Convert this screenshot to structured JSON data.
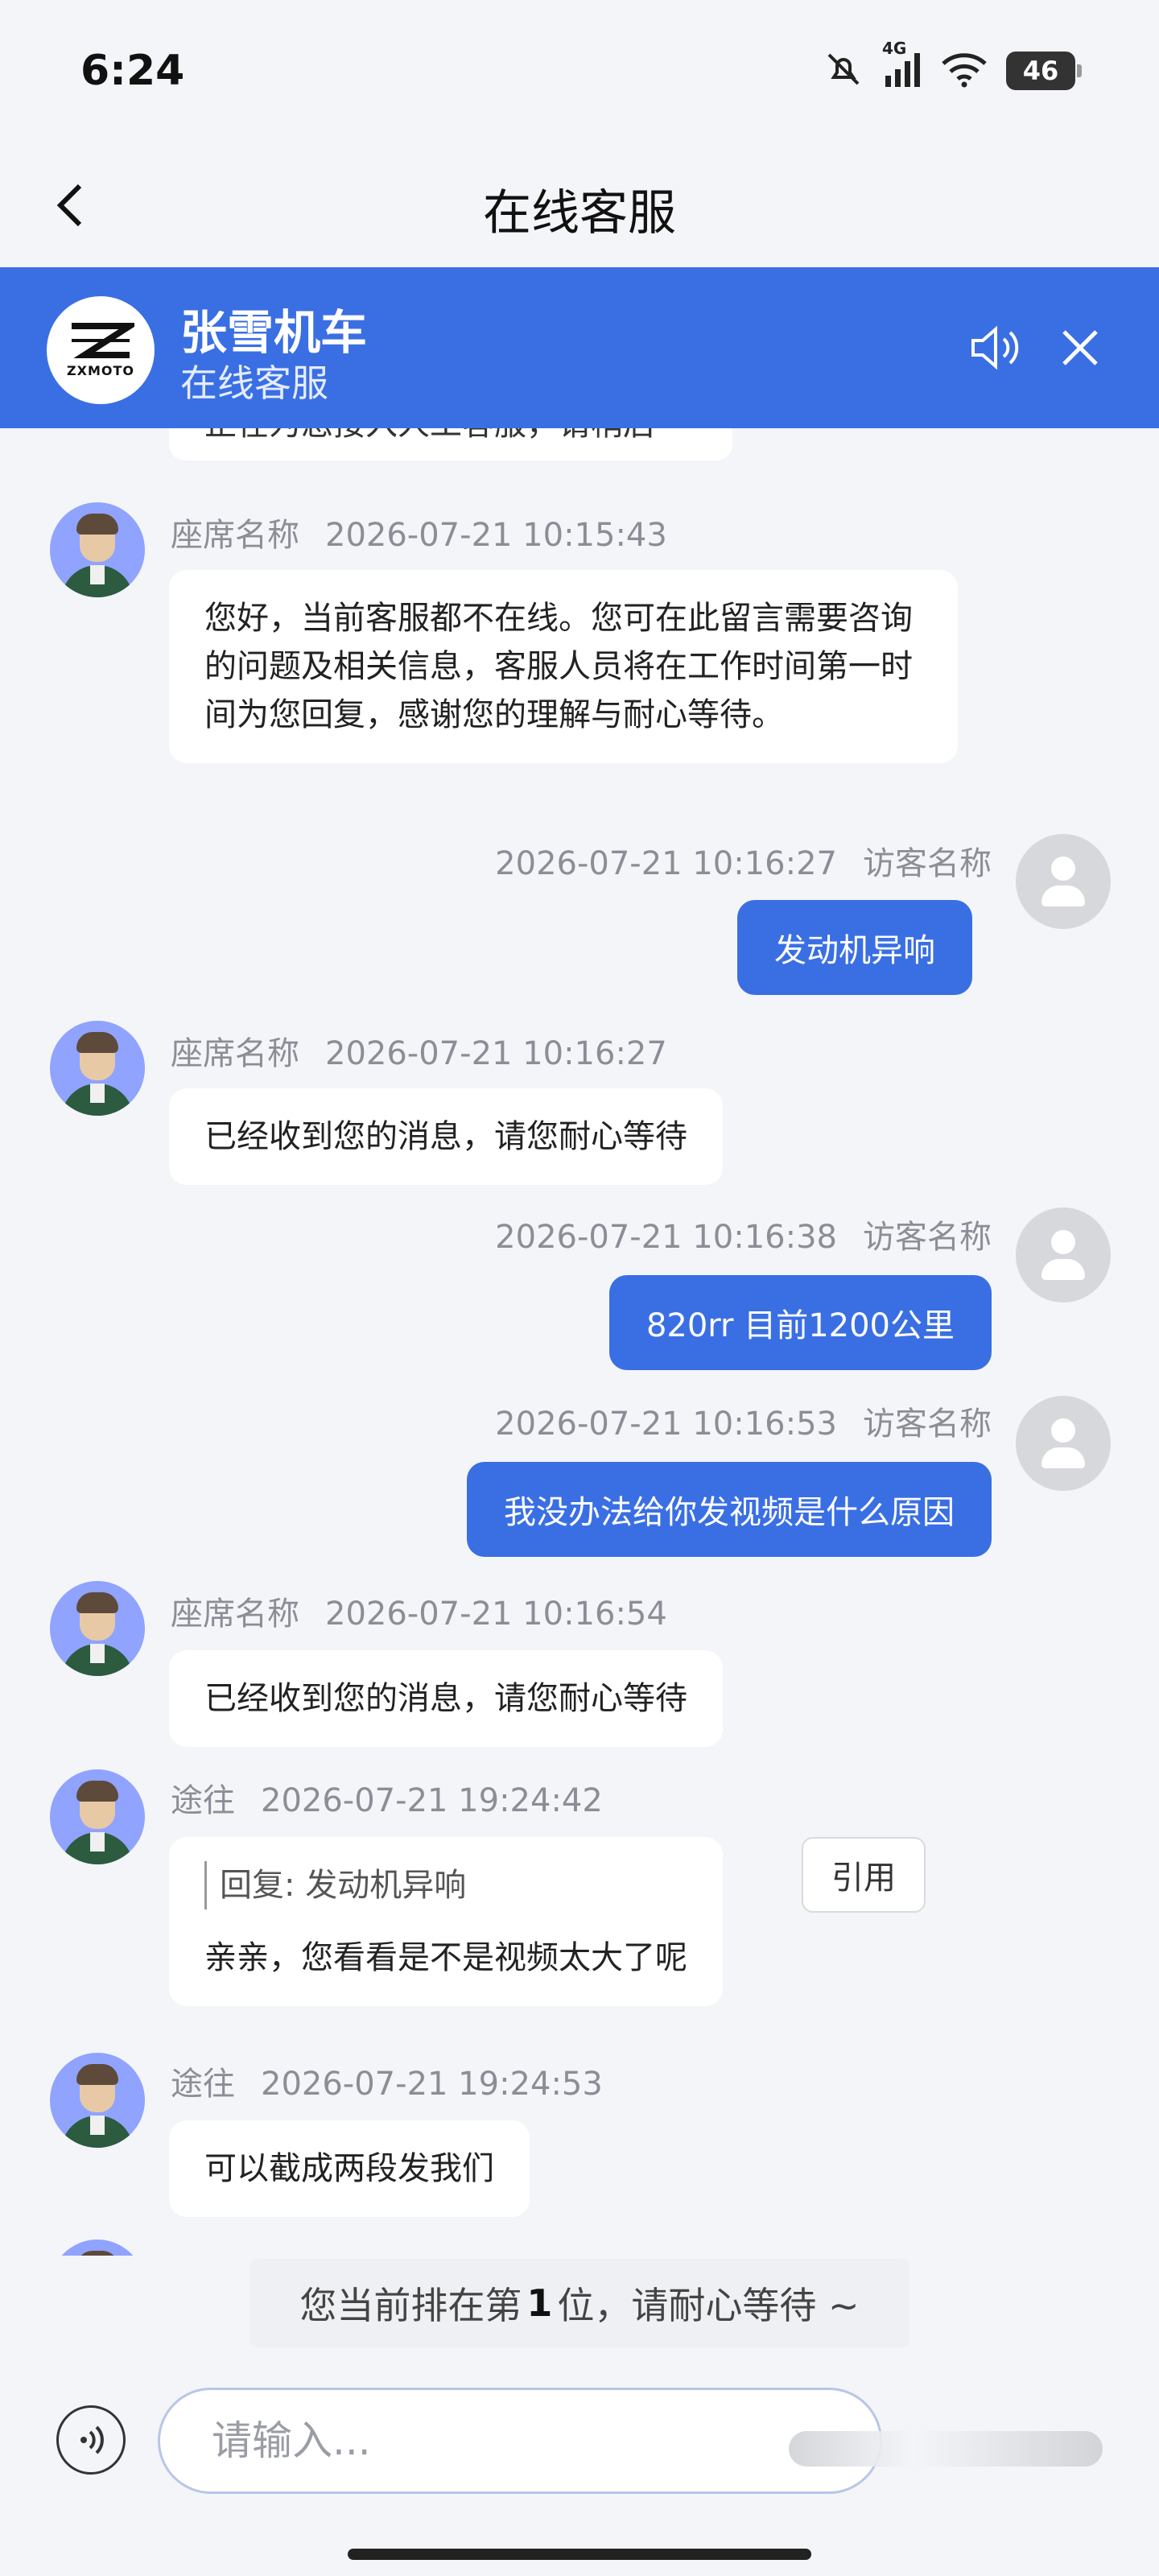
{
  "status_bar": {
    "time": "6:24",
    "battery": "46",
    "network": "4G"
  },
  "title_bar": {
    "title": "在线客服"
  },
  "brand": {
    "name": "张雪机车",
    "subtitle": "在线客服",
    "logo_text": "ZXMOTO"
  },
  "partial_message": "正在为您接入人工客服，请稍后",
  "messages": [
    {
      "sender": "座席名称",
      "time": "2026-07-21 10:15:43",
      "text": "您好，当前客服都不在线。您可在此留言需要咨询的问题及相关信息，客服人员将在工作时间第一时间为您回复，感谢您的理解与耐心等待。"
    },
    {
      "sender": "访客名称",
      "time": "2026-07-21 10:16:27",
      "text": "发动机异响"
    },
    {
      "sender": "座席名称",
      "time": "2026-07-21 10:16:27",
      "text": "已经收到您的消息，请您耐心等待"
    },
    {
      "sender": "访客名称",
      "time": "2026-07-21 10:16:38",
      "text": "820rr 目前1200公里"
    },
    {
      "sender": "访客名称",
      "time": "2026-07-21 10:16:53",
      "text": "我没办法给你发视频是什么原因"
    },
    {
      "sender": "座席名称",
      "time": "2026-07-21 10:16:54",
      "text": "已经收到您的消息，请您耐心等待"
    },
    {
      "sender": "途往",
      "time": "2026-07-21 19:24:42",
      "quote": "回复: 发动机异响",
      "text": "亲亲，您看看是不是视频太大了呢",
      "action": "引用"
    },
    {
      "sender": "途往",
      "time": "2026-07-21 19:24:53",
      "text": "可以截成两段发我们"
    }
  ],
  "queue": {
    "prefix": "您当前排在第",
    "position": "1",
    "suffix": "位，请耐心等待 ~"
  },
  "input": {
    "placeholder": "请输入..."
  }
}
